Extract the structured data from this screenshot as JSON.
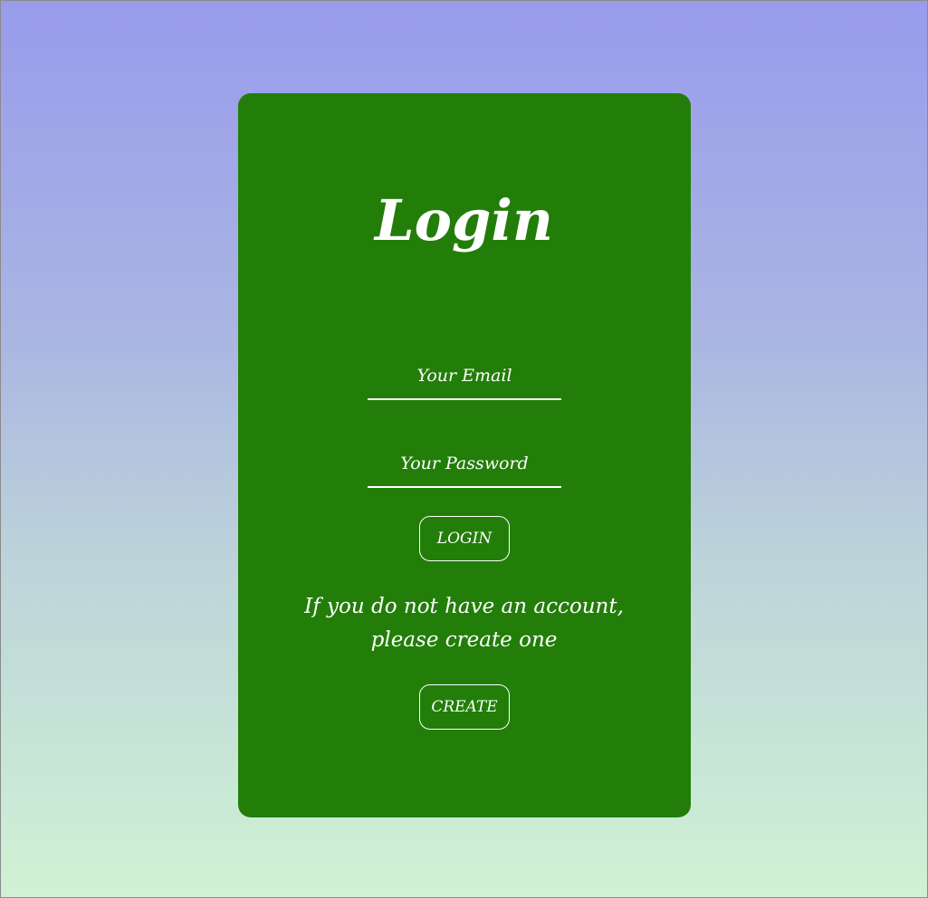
{
  "colors": {
    "card_background": "#227e09",
    "page_gradient_top": "#999bec",
    "page_gradient_bottom": "#d0f2d4",
    "text": "#ffffff"
  },
  "login_form": {
    "title": "Login",
    "email_placeholder": "Your Email",
    "email_value": "",
    "password_placeholder": "Your Password",
    "password_value": "",
    "login_button_label": "LOGIN",
    "signup_hint_line1": "If you do not have an account,",
    "signup_hint_line2": "please create one",
    "create_button_label": "CREATE"
  }
}
